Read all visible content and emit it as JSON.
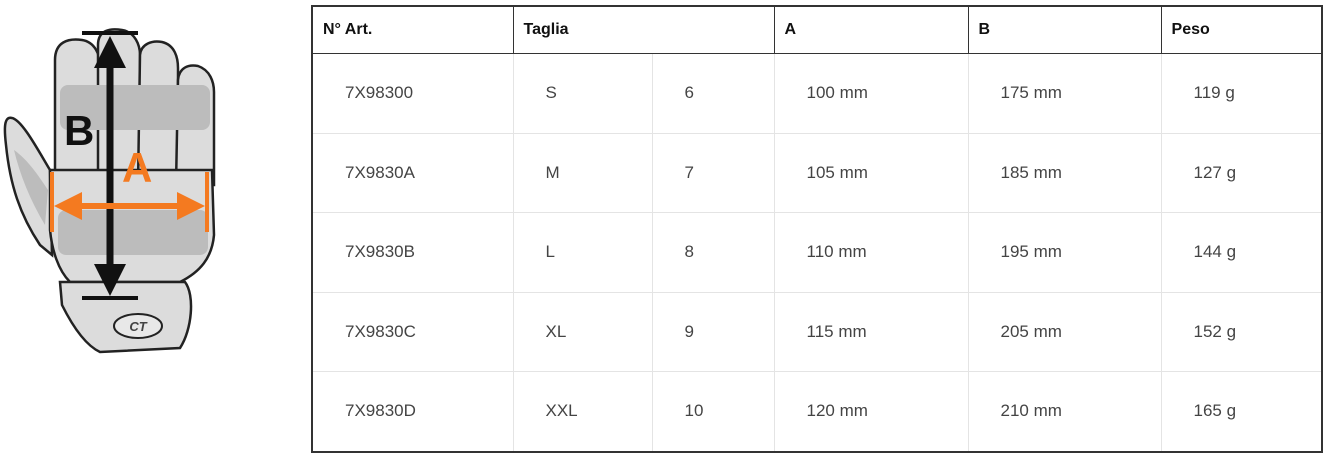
{
  "figure": {
    "label_a": "A",
    "label_b": "B",
    "logo_text": "CT",
    "colors": {
      "accent_orange": "#f47a20",
      "arrow_black": "#111111",
      "glove_fill": "#d8d8d8",
      "glove_outline": "#222222"
    }
  },
  "table": {
    "headers": [
      "N° Art.",
      "Taglia",
      "A",
      "B",
      "Peso"
    ],
    "rows": [
      {
        "art": "7X98300",
        "size": "S",
        "num": "6",
        "a": "100 mm",
        "b": "175 mm",
        "weight": "119 g"
      },
      {
        "art": "7X9830A",
        "size": "M",
        "num": "7",
        "a": "105 mm",
        "b": "185 mm",
        "weight": "127 g"
      },
      {
        "art": "7X9830B",
        "size": "L",
        "num": "8",
        "a": "110 mm",
        "b": "195 mm",
        "weight": "144 g"
      },
      {
        "art": "7X9830C",
        "size": "XL",
        "num": "9",
        "a": "115 mm",
        "b": "205 mm",
        "weight": "152 g"
      },
      {
        "art": "7X9830D",
        "size": "XXL",
        "num": "10",
        "a": "120 mm",
        "b": "210 mm",
        "weight": "165 g"
      }
    ]
  }
}
